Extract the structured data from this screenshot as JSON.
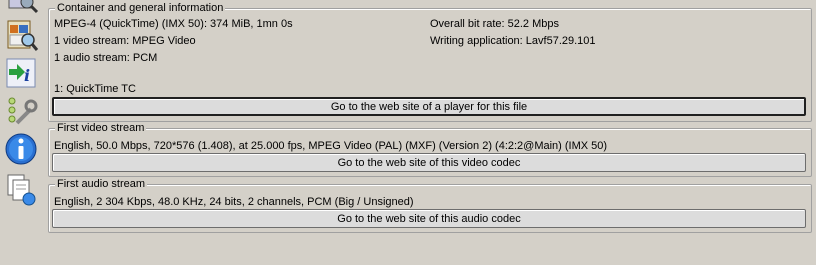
{
  "toolbar": {
    "icons": [
      "magnifier-icon",
      "report-icon",
      "import-info-icon",
      "settings-icon",
      "info-icon",
      "copy-files-icon"
    ]
  },
  "general": {
    "legend": "Container and general information",
    "left": [
      "MPEG-4 (QuickTime) (IMX 50): 374 MiB, 1mn 0s",
      "1 video stream: MPEG Video",
      "1 audio stream: PCM",
      "",
      "1: QuickTime TC"
    ],
    "right": [
      "Overall bit rate: 52.2 Mbps",
      "Writing application: Lavf57.29.101"
    ],
    "button": "Go to the web site of a player for this file"
  },
  "video": {
    "legend": "First video stream",
    "line": "English, 50.0 Mbps, 720*576 (1.408), at 25.000 fps, MPEG Video (PAL) (MXF) (Version 2) (4:2:2@Main) (IMX 50)",
    "button": "Go to the web site of this video codec"
  },
  "audio": {
    "legend": "First audio stream",
    "line": "English, 2 304 Kbps, 48.0 KHz, 24 bits, 2 channels, PCM (Big / Unsigned)",
    "button": "Go to the web site of this audio codec"
  }
}
